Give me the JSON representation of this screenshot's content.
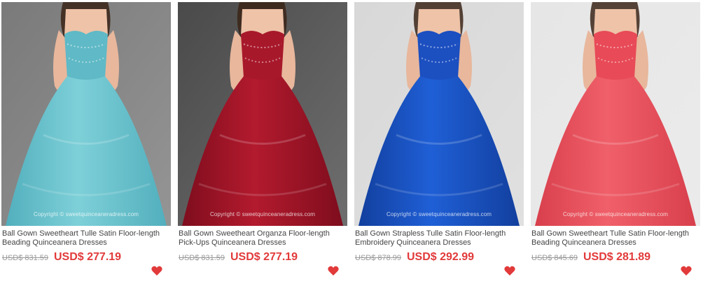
{
  "watermark": "Copyright © sweetquinceaneradress.com",
  "products": [
    {
      "title": "Ball Gown Sweetheart Tulle Satin Floor-length Beading Quinceanera Dresses",
      "old_price": "USD$ 831.59",
      "price": "USD$ 277.19",
      "icons": [
        "heart-icon"
      ],
      "colors": {
        "dress": "#7ed0d8",
        "dress_dark": "#52afbd",
        "bodice": "#5fb9c6",
        "bg": "#7a7a7a"
      }
    },
    {
      "title": "Ball Gown Sweetheart Organza Floor-length Pick-Ups Quinceanera Dresses",
      "old_price": "USD$ 831.59",
      "price": "USD$ 277.19",
      "icons": [
        "heart-icon"
      ],
      "colors": {
        "dress": "#b31a2e",
        "dress_dark": "#7e0d1d",
        "bodice": "#a8182b",
        "bg": "#4a4a4a"
      }
    },
    {
      "title": "Ball Gown Strapless Tulle Satin Floor-length Embroidery Quinceanera Dresses",
      "old_price": "USD$ 878.99",
      "price": "USD$ 292.99",
      "icons": [
        "heart-icon"
      ],
      "colors": {
        "dress": "#1f5fd6",
        "dress_dark": "#123f9e",
        "bodice": "#1c4fc0",
        "bg": "#d8d8d8"
      }
    },
    {
      "title": "Ball Gown Sweetheart Tulle Satin Floor-length Beading Quinceanera Dresses",
      "old_price": "USD$ 845.69",
      "price": "USD$ 281.89",
      "icons": [
        "heart-icon"
      ],
      "colors": {
        "dress": "#f0606a",
        "dress_dark": "#d83f4c",
        "bodice": "#e84a57",
        "bg": "#e6e6e6"
      }
    }
  ],
  "heart_color": "#e23a3a"
}
